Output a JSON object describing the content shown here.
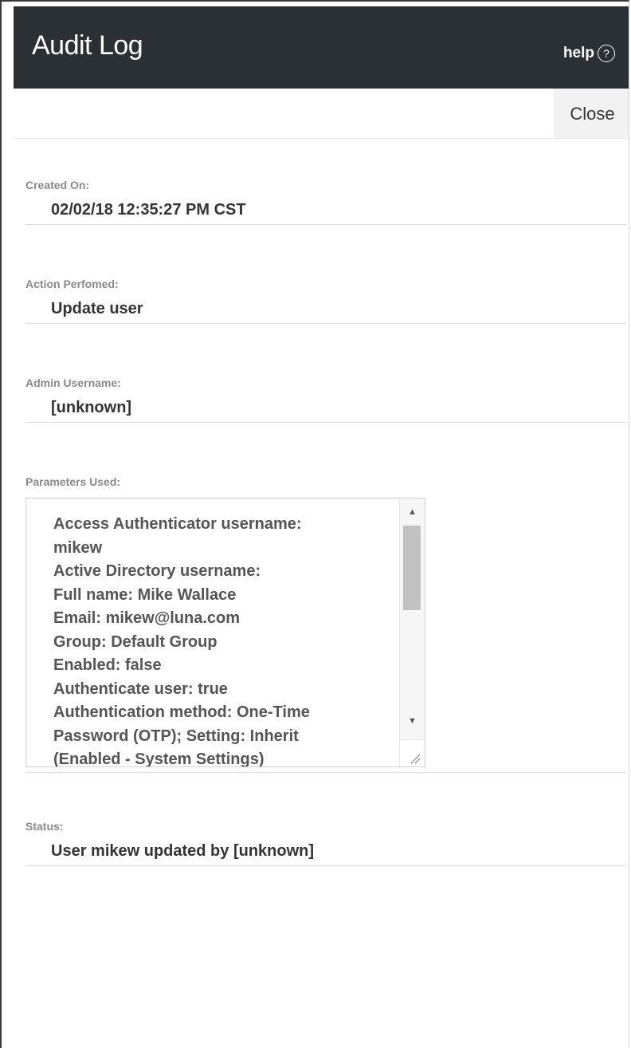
{
  "header": {
    "title": "Audit Log",
    "help_label": "help",
    "help_icon": "question-circle-icon"
  },
  "toolbar": {
    "close_label": "Close"
  },
  "fields": {
    "created_on": {
      "label": "Created On:",
      "value": "02/02/18 12:35:27 PM CST"
    },
    "action_performed": {
      "label": "Action Perfomed:",
      "value": "Update user"
    },
    "admin_username": {
      "label": "Admin Username:",
      "value": "[unknown]"
    },
    "parameters_used": {
      "label": "Parameters Used:",
      "lines": [
        "Access Authenticator username:",
        "mikew",
        "Active Directory username:",
        "Full name: Mike Wallace",
        "Email: mikew@luna.com",
        "Group: Default Group",
        "Enabled: false",
        "Authenticate user: true",
        "Authentication method: One-Time",
        "Password (OTP); Setting: Inherit",
        "(Enabled - System Settings)"
      ]
    },
    "status": {
      "label": "Status:",
      "value": "User mikew updated by [unknown]"
    }
  },
  "colors": {
    "header_bg": "#2b3035",
    "header_text": "#ffffff",
    "label_text": "#8a8a8a",
    "value_text": "#333333",
    "close_bg": "#f2f2f2"
  }
}
